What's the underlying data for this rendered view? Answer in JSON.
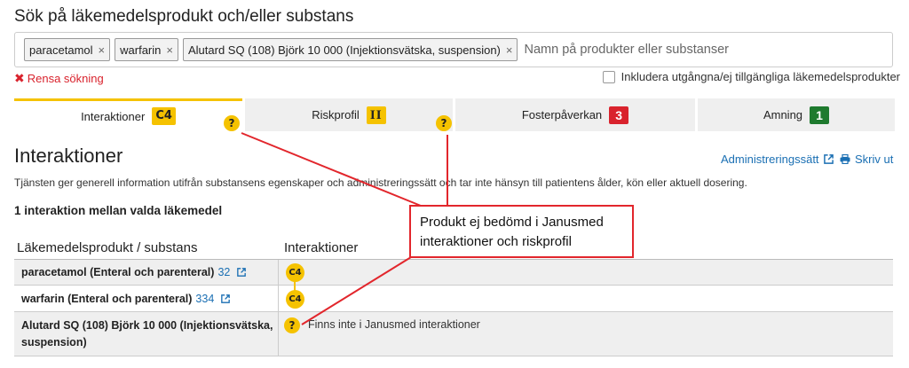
{
  "page": {
    "title": "Sök på läkemedelsprodukt och/eller substans"
  },
  "search": {
    "chips": [
      {
        "label": "paracetamol"
      },
      {
        "label": "warfarin"
      },
      {
        "label": "Alutard SQ (108) Björk 10 000 (Injektionsvätska, suspension)"
      }
    ],
    "chip_remove_glyph": "×",
    "placeholder": "Namn på produkter eller substanser",
    "clear_label": "Rensa sökning",
    "include_expired_label": "Inkludera utgångna/ej tillgängliga läkemedelsprodukter"
  },
  "tabs": [
    {
      "label": "Interaktioner",
      "badge": "C4",
      "badge_color": "#f5c200",
      "active": true
    },
    {
      "label": "Riskprofil",
      "badge": "II",
      "badge_color": "#f5c200",
      "active": false
    },
    {
      "label": "Fosterpåverkan",
      "badge": "3",
      "badge_color": "#d9232d",
      "active": false
    },
    {
      "label": "Amning",
      "badge": "1",
      "badge_color": "#1e7a2e",
      "active": false
    }
  ],
  "question_mark": "?",
  "section": {
    "title": "Interaktioner",
    "admin_link": "Administreringssätt",
    "print_link": "Skriv ut",
    "description": "Tjänsten ger generell information utifrån substansens egenskaper och administreringssätt och tar inte hänsyn till patientens ålder, kön eller aktuell dosering.",
    "interaction_count": "1 interaktion mellan valda läkemedel"
  },
  "table": {
    "headers": {
      "product": "Läkemedelsprodukt / substans",
      "interactions": "Interaktioner"
    },
    "rows": [
      {
        "name": "paracetamol (Enteral och parenteral)",
        "count": "32",
        "interaction": "C4"
      },
      {
        "name": "warfarin (Enteral och parenteral)",
        "count": "334",
        "interaction": "C4"
      },
      {
        "name_line1": "Alutard SQ (108) Björk 10 000 (Injektionsvätska,",
        "name_line2": "suspension)",
        "interaction": "?",
        "note": "Finns inte i Janusmed interaktioner"
      }
    ]
  },
  "annotation": {
    "text_line1": "Produkt ej bedömd i Janusmed",
    "text_line2": "interaktioner och riskprofil",
    "color": "#e2262c"
  },
  "colors": {
    "accent_yellow": "#f5c200",
    "link_blue": "#1a6fb3",
    "danger_red": "#d9232d",
    "success_green": "#1e7a2e"
  }
}
